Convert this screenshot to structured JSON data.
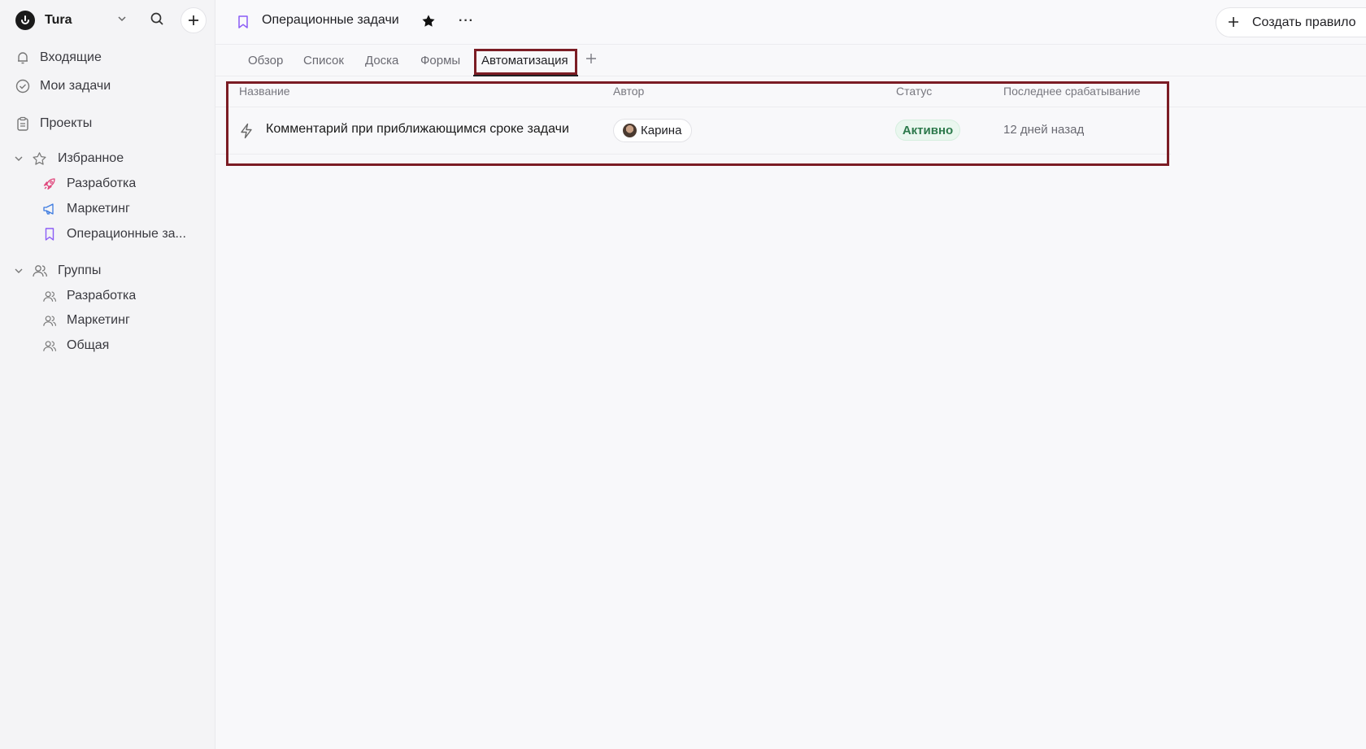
{
  "workspace": {
    "name": "Tura"
  },
  "sidebar": {
    "nav": [
      {
        "label": "Входящие",
        "icon": "bell-icon"
      },
      {
        "label": "Мои задачи",
        "icon": "check-circle-icon"
      },
      {
        "label": "Проекты",
        "icon": "clipboard-icon"
      }
    ],
    "favorites": {
      "label": "Избранное",
      "items": [
        {
          "label": "Разработка",
          "icon": "rocket-icon",
          "color": "#e0457b"
        },
        {
          "label": "Маркетинг",
          "icon": "megaphone-icon",
          "color": "#3d7be0"
        },
        {
          "label": "Операционные за...",
          "icon": "bookmark-icon",
          "color": "#8b5cf6"
        }
      ]
    },
    "groups": {
      "label": "Группы",
      "items": [
        {
          "label": "Разработка",
          "icon": "users-icon"
        },
        {
          "label": "Маркетинг",
          "icon": "users-icon"
        },
        {
          "label": "Общая",
          "icon": "users-icon"
        }
      ]
    }
  },
  "header": {
    "title": "Операционные задачи",
    "more": "···",
    "create_rule": "Создать правило"
  },
  "tabs": [
    {
      "label": "Обзор"
    },
    {
      "label": "Список"
    },
    {
      "label": "Доска"
    },
    {
      "label": "Формы"
    },
    {
      "label": "Автоматизация",
      "active": true
    }
  ],
  "table": {
    "columns": [
      "Название",
      "Автор",
      "Статус",
      "Последнее срабатывание"
    ],
    "rows": [
      {
        "name": "Комментарий при приближающимся сроке задачи",
        "author": "Карина",
        "status": "Активно",
        "last_run": "12 дней назад"
      }
    ]
  },
  "colors": {
    "highlight": "#7b1c24",
    "status_active": "#2d7a4c"
  }
}
